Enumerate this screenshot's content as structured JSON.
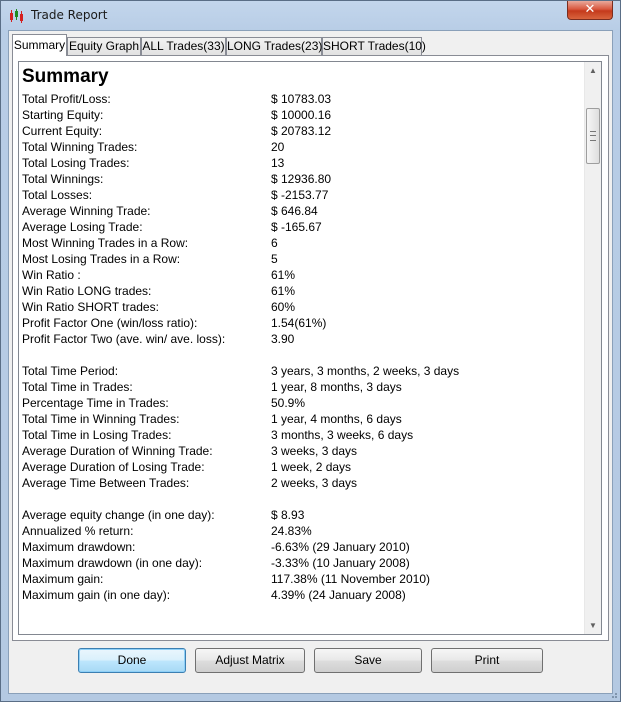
{
  "window": {
    "title": "Trade Report",
    "close_label": "✕"
  },
  "tabs": [
    {
      "label": "Summary",
      "active": true
    },
    {
      "label": "Equity Graph",
      "active": false
    },
    {
      "label": "ALL Trades(33)",
      "active": false
    },
    {
      "label": "LONG Trades(23)",
      "active": false
    },
    {
      "label": "SHORT Trades(10)",
      "active": false
    }
  ],
  "summary": {
    "heading": "Summary",
    "section1": [
      {
        "label": "Total Profit/Loss:",
        "value": "$ 10783.03"
      },
      {
        "label": "Starting Equity:",
        "value": "$ 10000.16"
      },
      {
        "label": "Current Equity:",
        "value": "$ 20783.12"
      },
      {
        "label": "Total Winning Trades:",
        "value": "20"
      },
      {
        "label": "Total Losing Trades:",
        "value": "13"
      },
      {
        "label": "Total Winnings:",
        "value": "$ 12936.80"
      },
      {
        "label": "Total Losses:",
        "value": "$ -2153.77"
      },
      {
        "label": "Average Winning Trade:",
        "value": "$ 646.84"
      },
      {
        "label": "Average Losing Trade:",
        "value": "$ -165.67"
      },
      {
        "label": "Most Winning Trades in a Row:",
        "value": "6"
      },
      {
        "label": "Most Losing Trades in a Row:",
        "value": "5"
      },
      {
        "label": "Win Ratio :",
        "value": "61%"
      },
      {
        "label": "Win Ratio LONG trades:",
        "value": "61%"
      },
      {
        "label": "Win Ratio SHORT trades:",
        "value": "60%"
      },
      {
        "label": "Profit Factor One (win/loss ratio):",
        "value": "1.54(61%)"
      },
      {
        "label": "Profit Factor Two (ave. win/ ave. loss):",
        "value": "3.90"
      }
    ],
    "section2": [
      {
        "label": "Total Time Period:",
        "value": "3 years, 3 months, 2 weeks, 3 days"
      },
      {
        "label": "Total Time in Trades:",
        "value": "1 year, 8 months, 3 days"
      },
      {
        "label": "Percentage Time in Trades:",
        "value": "50.9%"
      },
      {
        "label": "Total Time in Winning Trades:",
        "value": "1 year, 4 months, 6 days"
      },
      {
        "label": "Total Time in Losing Trades:",
        "value": "3 months, 3 weeks, 6 days"
      },
      {
        "label": "Average Duration of Winning Trade:",
        "value": "3 weeks, 3 days"
      },
      {
        "label": "Average Duration of Losing Trade:",
        "value": "1 week, 2 days"
      },
      {
        "label": "Average Time Between Trades:",
        "value": "2 weeks, 3 days"
      }
    ],
    "section3": [
      {
        "label": "Average equity change (in one day):",
        "value": "$ 8.93"
      },
      {
        "label": "Annualized % return:",
        "value": "24.83%"
      },
      {
        "label": "Maximum drawdown:",
        "value": "-6.63% (29 January 2010)"
      },
      {
        "label": "Maximum drawdown (in one day):",
        "value": "-3.33% (10 January 2008)"
      },
      {
        "label": "Maximum gain:",
        "value": "117.38% (11 November 2010)"
      },
      {
        "label": "Maximum gain (in one day):",
        "value": "4.39% (24 January 2008)"
      }
    ]
  },
  "buttons": {
    "done": "Done",
    "adjust_matrix": "Adjust Matrix",
    "save": "Save",
    "print": "Print"
  },
  "icons": {
    "app": "candlestick-chart-icon",
    "scroll_up": "▲",
    "scroll_down": "▼"
  }
}
